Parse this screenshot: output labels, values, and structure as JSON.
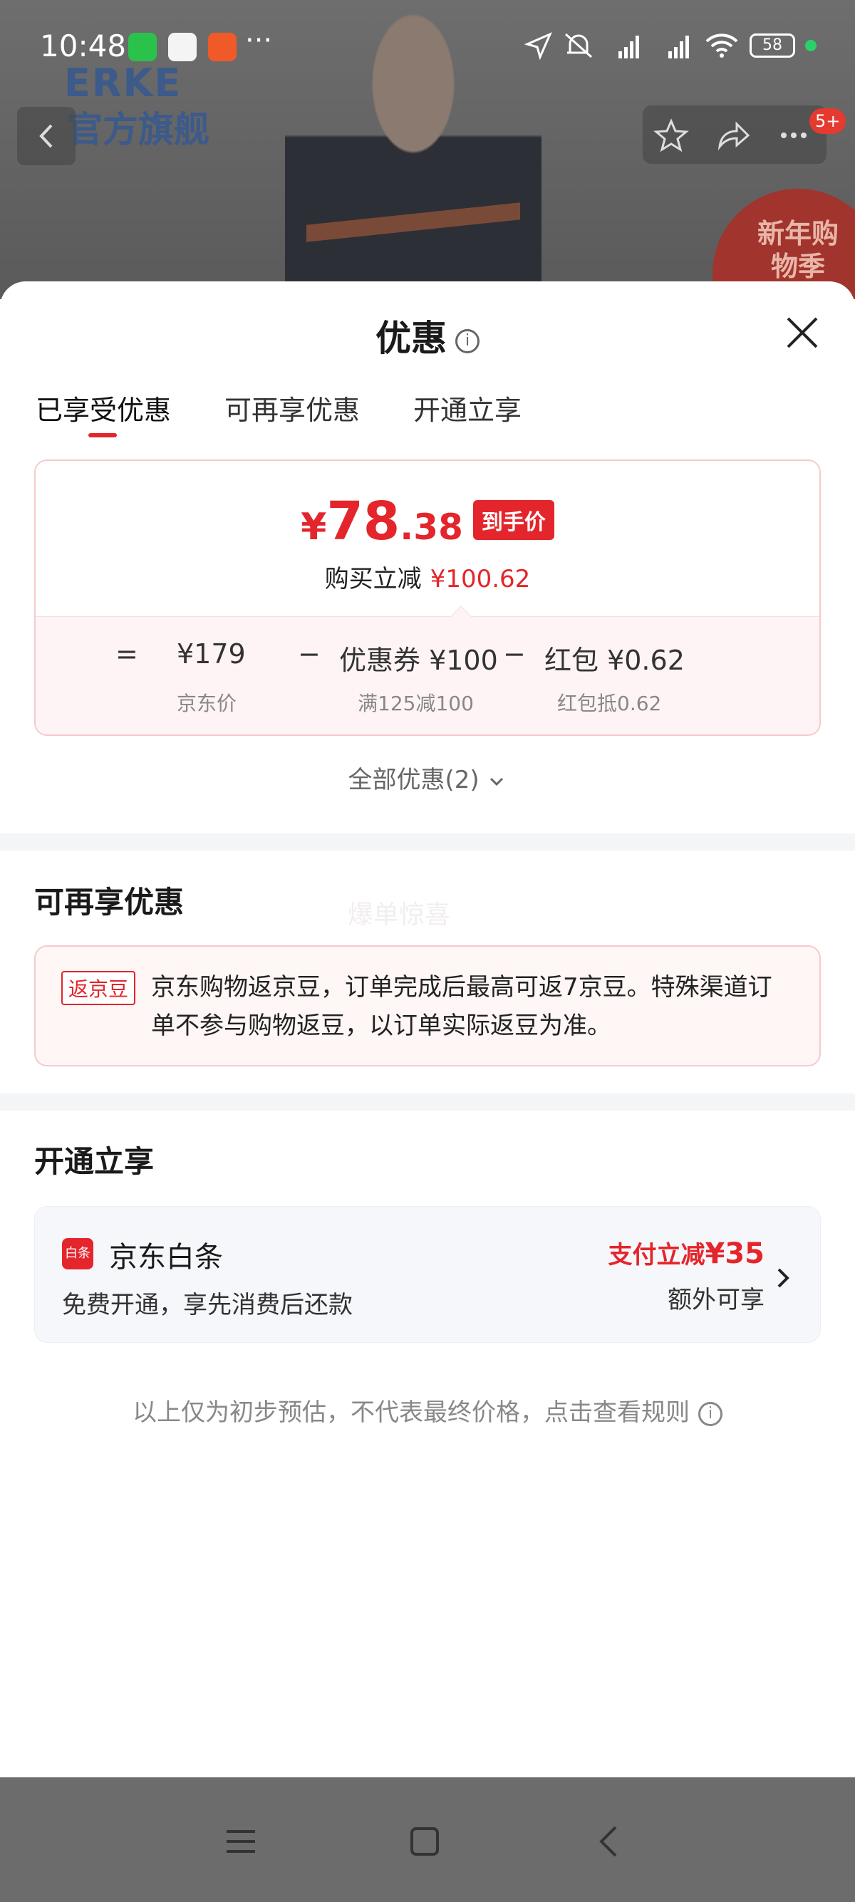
{
  "status_bar": {
    "time": "10:48",
    "battery": "58"
  },
  "background_page": {
    "brand_logo": "ERKE",
    "brand_sub": "官方旗舰",
    "promo_text": "新年购物季",
    "badge": "5+"
  },
  "sheet": {
    "title": "优惠",
    "tabs": [
      "已享受优惠",
      "可再享优惠",
      "开通立享"
    ],
    "active_tab": 0,
    "price": {
      "yen": "¥",
      "integer": "78",
      "decimal": ".38",
      "tag": "到手价",
      "save_label": "购买立减",
      "save_value": "¥100.62"
    },
    "formula": {
      "eq": "=",
      "minus": "−",
      "jd_price": "¥179",
      "jd_price_label": "京东价",
      "coupon": "优惠券 ¥100",
      "coupon_label": "满125减100",
      "redpacket": "红包 ¥0.62",
      "redpacket_label": "红包抵0.62"
    },
    "all_offers": "全部优惠(2)",
    "watermark": "爆单惊喜",
    "section_more": {
      "title": "可再享优惠",
      "tag": "返京豆",
      "text": "京东购物返京豆，订单完成后最高可返7京豆。特殊渠道订单不参与购物返豆，以订单实际返豆为准。"
    },
    "section_open": {
      "title": "开通立享",
      "icon_label": "白条",
      "name": "京东白条",
      "desc": "免费开通，享先消费后还款",
      "promo_prefix": "支付立减",
      "promo_value": "¥35",
      "extra": "额外可享"
    },
    "disclaimer": "以上仅为初步预估，不代表最终价格，点击查看规则"
  },
  "colors": {
    "accent": "#e4252b",
    "border_pink": "#f6c9cd"
  }
}
